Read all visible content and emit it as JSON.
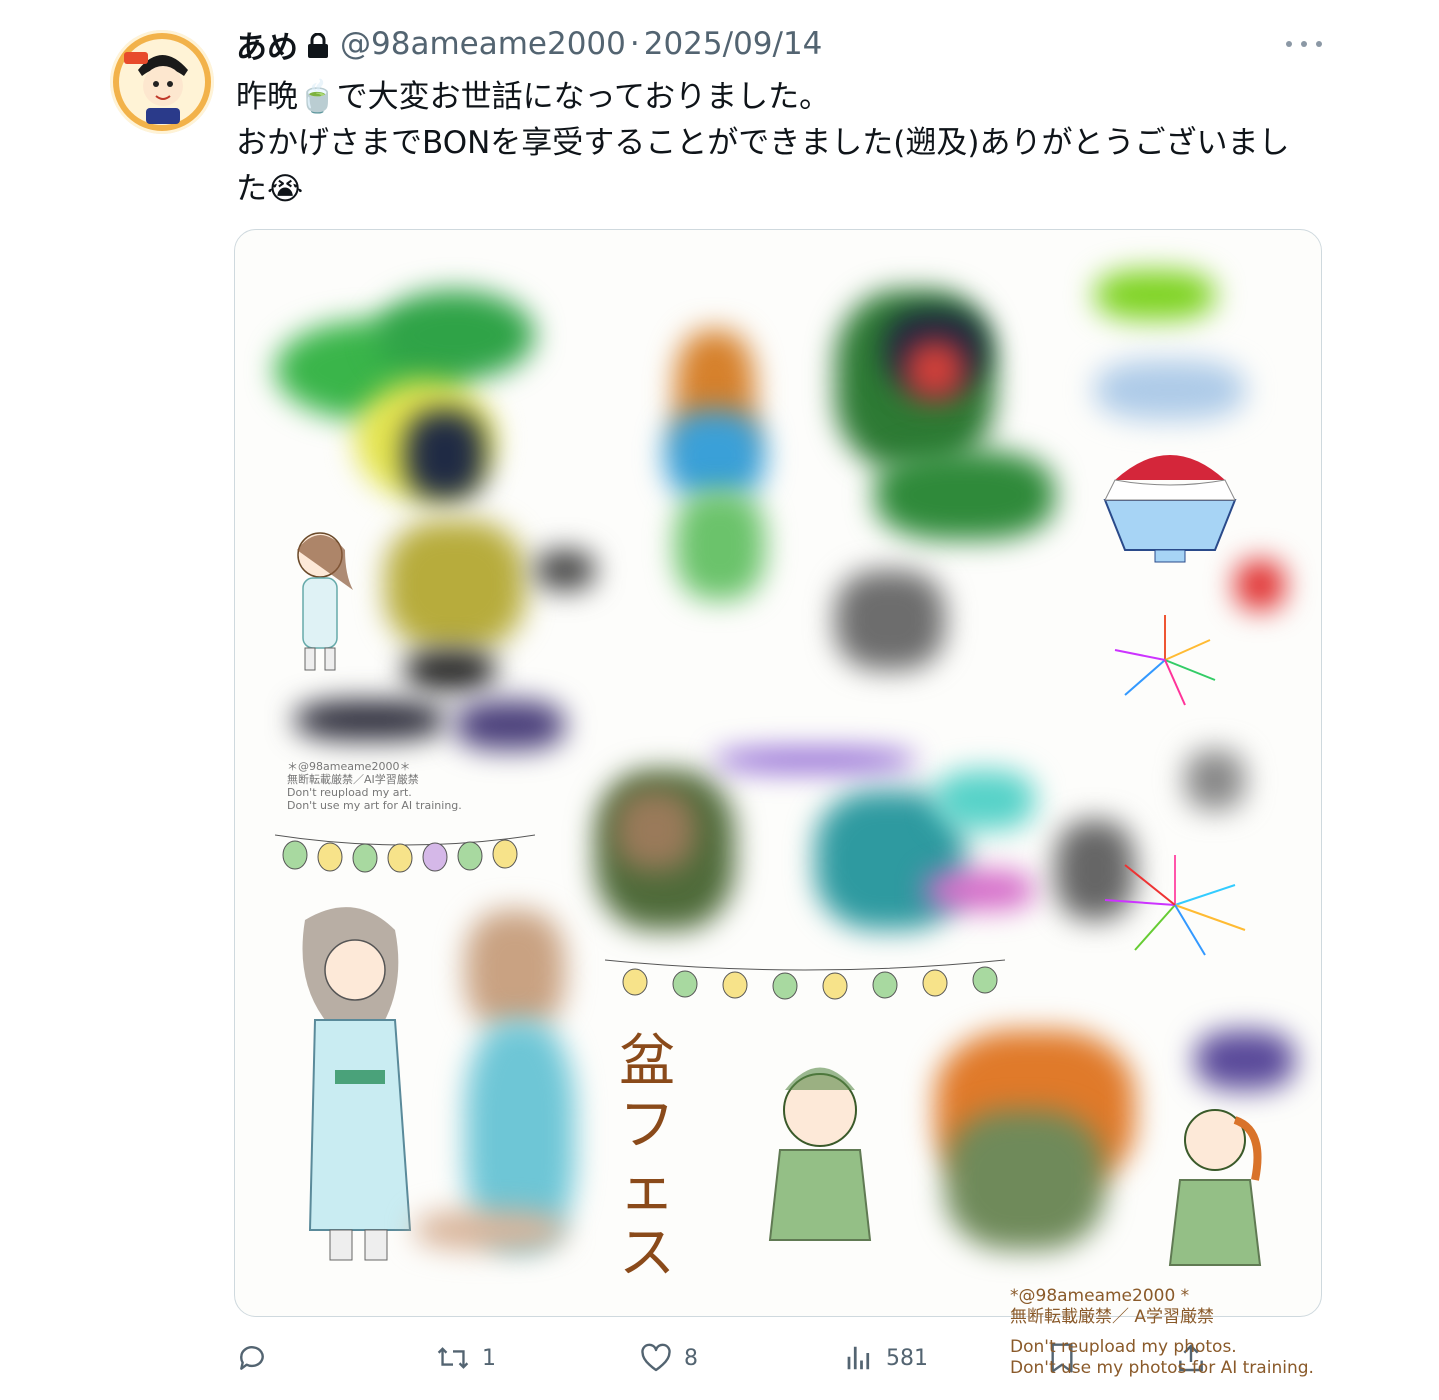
{
  "tweet": {
    "display_name": "あめ",
    "handle": "@98ameame2000",
    "separator": "·",
    "date": "2025/09/14",
    "text_line1": "昨晩🍵で大変お世話になっておりました。",
    "text_line2": "おかげさまでBONを享受することができました(遡及)ありがとうございまし",
    "text_line3": "た😭"
  },
  "media": {
    "watermark_left": [
      "＊@98ameame2000＊",
      "無断転載厳禁／AI学習厳禁",
      "Don't reupload my art.",
      "Don't use my art for AI training."
    ],
    "title_vertical": "盆フェス",
    "watermark_right": [
      "*@98ameame2000 *",
      "無断転載厳禁／ A学習厳禁",
      "Don't reupload my photos.",
      "Don't use my photos for AI training."
    ]
  },
  "actions": {
    "reply_count": "",
    "retweet_count": "1",
    "like_count": "8",
    "views_count": "581"
  }
}
